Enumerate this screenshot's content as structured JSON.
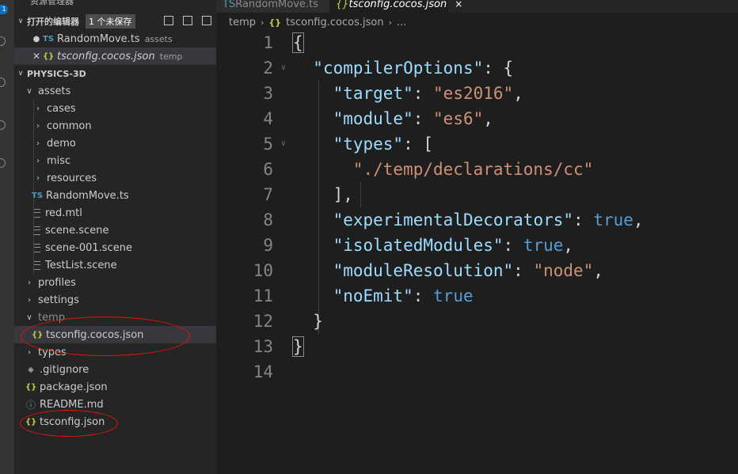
{
  "sidebar": {
    "cut_title": "资源管理器",
    "open_editors": {
      "title": "打开的编辑器",
      "badge": "1 个未保存"
    },
    "open_files": [
      {
        "name": "RandomMove.ts",
        "desc": "assets",
        "icon": "TS"
      },
      {
        "name": "tsconfig.cocos.json",
        "desc": "temp",
        "icon": "{}"
      }
    ],
    "project": "PHYSICS-3D",
    "tree": {
      "assets": "assets",
      "assets_children": [
        "cases",
        "common",
        "demo",
        "misc",
        "resources"
      ],
      "assets_files": [
        "RandomMove.ts",
        "red.mtl",
        "scene.scene",
        "scene-001.scene",
        "TestList.scene"
      ],
      "profiles": "profiles",
      "settings": "settings",
      "temp": "temp",
      "temp_file": "tsconfig.cocos.json",
      "types": "types",
      "root_files": [
        ".gitignore",
        "package.json",
        "README.md",
        "tsconfig.json"
      ]
    },
    "icons": {
      "ts": "TS",
      "json": "{}",
      "info": "ⓘ",
      "git": "◆"
    }
  },
  "tabs": [
    {
      "label": "RandomMove.ts",
      "icon": "TS"
    },
    {
      "label": "tsconfig.cocos.json",
      "icon": "{}",
      "close": "×"
    }
  ],
  "breadcrumb": {
    "folder": "temp",
    "icon": "{}",
    "file": "tsconfig.cocos.json",
    "more": "..."
  },
  "editor": {
    "line_numbers": [
      "1",
      "2",
      "3",
      "4",
      "5",
      "6",
      "7",
      "8",
      "9",
      "10",
      "11",
      "12",
      "13",
      "14"
    ],
    "lines": [
      {
        "parts": [
          [
            "{",
            "p"
          ]
        ]
      },
      {
        "parts": [
          [
            "  ",
            "p"
          ],
          [
            "\"compilerOptions\"",
            "k"
          ],
          [
            ": {",
            "p"
          ]
        ]
      },
      {
        "parts": [
          [
            "    ",
            "p"
          ],
          [
            "\"target\"",
            "k"
          ],
          [
            ": ",
            "p"
          ],
          [
            "\"es2016\"",
            "s"
          ],
          [
            ",",
            "p"
          ]
        ]
      },
      {
        "parts": [
          [
            "    ",
            "p"
          ],
          [
            "\"module\"",
            "k"
          ],
          [
            ": ",
            "p"
          ],
          [
            "\"es6\"",
            "s"
          ],
          [
            ",",
            "p"
          ]
        ]
      },
      {
        "parts": [
          [
            "    ",
            "p"
          ],
          [
            "\"types\"",
            "k"
          ],
          [
            ": [",
            "p"
          ]
        ]
      },
      {
        "parts": [
          [
            "      ",
            "p"
          ],
          [
            "\"./temp/declarations/cc\"",
            "s"
          ]
        ]
      },
      {
        "parts": [
          [
            "    ",
            "p"
          ],
          [
            "],",
            "p"
          ]
        ]
      },
      {
        "parts": [
          [
            "    ",
            "p"
          ],
          [
            "\"experimentalDecorators\"",
            "k"
          ],
          [
            ": ",
            "p"
          ],
          [
            "true",
            "b"
          ],
          [
            ",",
            "p"
          ]
        ]
      },
      {
        "parts": [
          [
            "    ",
            "p"
          ],
          [
            "\"isolatedModules\"",
            "k"
          ],
          [
            ": ",
            "p"
          ],
          [
            "true",
            "b"
          ],
          [
            ",",
            "p"
          ]
        ]
      },
      {
        "parts": [
          [
            "    ",
            "p"
          ],
          [
            "\"moduleResolution\"",
            "k"
          ],
          [
            ": ",
            "p"
          ],
          [
            "\"node\"",
            "s"
          ],
          [
            ",",
            "p"
          ]
        ]
      },
      {
        "parts": [
          [
            "    ",
            "p"
          ],
          [
            "\"noEmit\"",
            "k"
          ],
          [
            ": ",
            "p"
          ],
          [
            "true",
            "b"
          ]
        ]
      },
      {
        "parts": [
          [
            "  ",
            "p"
          ],
          [
            "}",
            "p"
          ]
        ]
      },
      {
        "parts": [
          [
            "}",
            "p"
          ]
        ]
      },
      {
        "parts": []
      }
    ]
  },
  "colors": {
    "key": "#9cdcfe",
    "string": "#ce9178",
    "boolean": "#569cd6",
    "annotation": "#e51400"
  }
}
